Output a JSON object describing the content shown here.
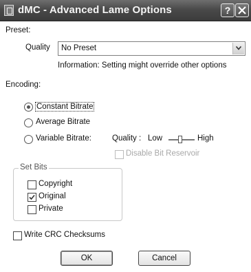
{
  "window": {
    "title": "dMC - Advanced Lame Options",
    "help_glyph": "?",
    "icons": {
      "app": "app-icon",
      "help": "help-icon",
      "close": "close-icon"
    }
  },
  "preset": {
    "section_label": "Preset:",
    "quality_label": "Quality",
    "quality_value": "No Preset",
    "info_text": "Information: Setting might override other options"
  },
  "encoding": {
    "section_label": "Encoding:",
    "selected": "Constant Bitrate",
    "options": [
      {
        "label": "Constant Bitrate",
        "checked": true
      },
      {
        "label": "Average Bitrate",
        "checked": false
      },
      {
        "label": "Variable Bitrate:",
        "checked": false
      }
    ],
    "vbr_quality_label": "Quality :",
    "vbr_low_label": "Low",
    "vbr_high_label": "High",
    "vbr_quality_level": 0.45,
    "disable_bit_reservoir": {
      "label": "Disable Bit Reservoir",
      "checked": false,
      "enabled": false
    }
  },
  "set_bits": {
    "title": "Set Bits",
    "items": [
      {
        "label": "Copyright",
        "checked": false
      },
      {
        "label": "Original",
        "checked": true
      },
      {
        "label": "Private",
        "checked": false
      }
    ]
  },
  "crc": {
    "label": "Write CRC Checksums",
    "checked": false
  },
  "buttons": {
    "ok": "OK",
    "cancel": "Cancel"
  }
}
